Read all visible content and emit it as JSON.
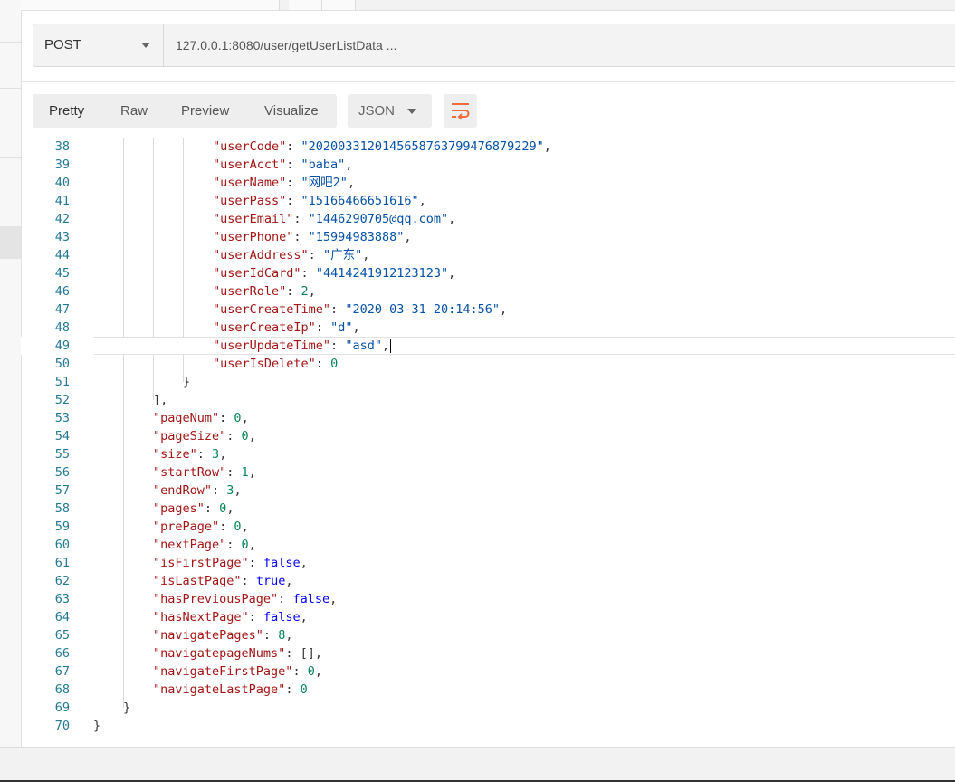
{
  "request": {
    "method": "POST",
    "url": "127.0.0.1:8080/user/getUserListData ..."
  },
  "response_toolbar": {
    "view_tabs": [
      {
        "label": "Pretty",
        "active": true
      },
      {
        "label": "Raw",
        "active": false
      },
      {
        "label": "Preview",
        "active": false
      },
      {
        "label": "Visualize",
        "active": false
      }
    ],
    "format": "JSON",
    "wrap_icon": "wrap-lines-icon"
  },
  "colors": {
    "accent": "#f26b3a",
    "key": "#a31515",
    "string": "#0451a5",
    "number": "#098658",
    "boolean": "#0000ff",
    "line_number": "#237893"
  },
  "editor": {
    "active_line": 49,
    "lines": [
      {
        "n": "38",
        "indent": 4,
        "key": "\"userCode\"",
        "value": "\"2020033120145658763799476879229\"",
        "vtype": "s",
        "comma": true
      },
      {
        "n": "39",
        "indent": 4,
        "key": "\"userAcct\"",
        "value": "\"baba\"",
        "vtype": "s",
        "comma": true
      },
      {
        "n": "40",
        "indent": 4,
        "key": "\"userName\"",
        "value": "\"网吧2\"",
        "vtype": "s",
        "comma": true
      },
      {
        "n": "41",
        "indent": 4,
        "key": "\"userPass\"",
        "value": "\"15166466651616\"",
        "vtype": "s",
        "comma": true
      },
      {
        "n": "42",
        "indent": 4,
        "key": "\"userEmail\"",
        "value": "\"1446290705@qq.com\"",
        "vtype": "s",
        "comma": true
      },
      {
        "n": "43",
        "indent": 4,
        "key": "\"userPhone\"",
        "value": "\"15994983888\"",
        "vtype": "s",
        "comma": true
      },
      {
        "n": "44",
        "indent": 4,
        "key": "\"userAddress\"",
        "value": "\"广东\"",
        "vtype": "s",
        "comma": true
      },
      {
        "n": "45",
        "indent": 4,
        "key": "\"userIdCard\"",
        "value": "\"4414241912123123\"",
        "vtype": "s",
        "comma": true
      },
      {
        "n": "46",
        "indent": 4,
        "key": "\"userRole\"",
        "value": "2",
        "vtype": "n",
        "comma": true
      },
      {
        "n": "47",
        "indent": 4,
        "key": "\"userCreateTime\"",
        "value": "\"2020-03-31 20:14:56\"",
        "vtype": "s",
        "comma": true
      },
      {
        "n": "48",
        "indent": 4,
        "key": "\"userCreateIp\"",
        "value": "\"d\"",
        "vtype": "s",
        "comma": true
      },
      {
        "n": "49",
        "indent": 4,
        "key": "\"userUpdateTime\"",
        "value": "\"asd\"",
        "vtype": "s",
        "comma": true
      },
      {
        "n": "50",
        "indent": 4,
        "key": "\"userIsDelete\"",
        "value": "0",
        "vtype": "n",
        "comma": false
      },
      {
        "n": "51",
        "indent": 3,
        "punct": "}"
      },
      {
        "n": "52",
        "indent": 2,
        "punct": "],"
      },
      {
        "n": "53",
        "indent": 2,
        "key": "\"pageNum\"",
        "value": "0",
        "vtype": "n",
        "comma": true
      },
      {
        "n": "54",
        "indent": 2,
        "key": "\"pageSize\"",
        "value": "0",
        "vtype": "n",
        "comma": true
      },
      {
        "n": "55",
        "indent": 2,
        "key": "\"size\"",
        "value": "3",
        "vtype": "n",
        "comma": true
      },
      {
        "n": "56",
        "indent": 2,
        "key": "\"startRow\"",
        "value": "1",
        "vtype": "n",
        "comma": true
      },
      {
        "n": "57",
        "indent": 2,
        "key": "\"endRow\"",
        "value": "3",
        "vtype": "n",
        "comma": true
      },
      {
        "n": "58",
        "indent": 2,
        "key": "\"pages\"",
        "value": "0",
        "vtype": "n",
        "comma": true
      },
      {
        "n": "59",
        "indent": 2,
        "key": "\"prePage\"",
        "value": "0",
        "vtype": "n",
        "comma": true
      },
      {
        "n": "60",
        "indent": 2,
        "key": "\"nextPage\"",
        "value": "0",
        "vtype": "n",
        "comma": true
      },
      {
        "n": "61",
        "indent": 2,
        "key": "\"isFirstPage\"",
        "value": "false",
        "vtype": "b",
        "comma": true
      },
      {
        "n": "62",
        "indent": 2,
        "key": "\"isLastPage\"",
        "value": "true",
        "vtype": "b",
        "comma": true
      },
      {
        "n": "63",
        "indent": 2,
        "key": "\"hasPreviousPage\"",
        "value": "false",
        "vtype": "b",
        "comma": true
      },
      {
        "n": "64",
        "indent": 2,
        "key": "\"hasNextPage\"",
        "value": "false",
        "vtype": "b",
        "comma": true
      },
      {
        "n": "65",
        "indent": 2,
        "key": "\"navigatePages\"",
        "value": "8",
        "vtype": "n",
        "comma": true
      },
      {
        "n": "66",
        "indent": 2,
        "key": "\"navigatepageNums\"",
        "value": "[]",
        "vtype": "p",
        "comma": true
      },
      {
        "n": "67",
        "indent": 2,
        "key": "\"navigateFirstPage\"",
        "value": "0",
        "vtype": "n",
        "comma": true
      },
      {
        "n": "68",
        "indent": 2,
        "key": "\"navigateLastPage\"",
        "value": "0",
        "vtype": "n",
        "comma": false
      },
      {
        "n": "69",
        "indent": 1,
        "punct": "}"
      },
      {
        "n": "70",
        "indent": 0,
        "punct": "}"
      }
    ]
  }
}
